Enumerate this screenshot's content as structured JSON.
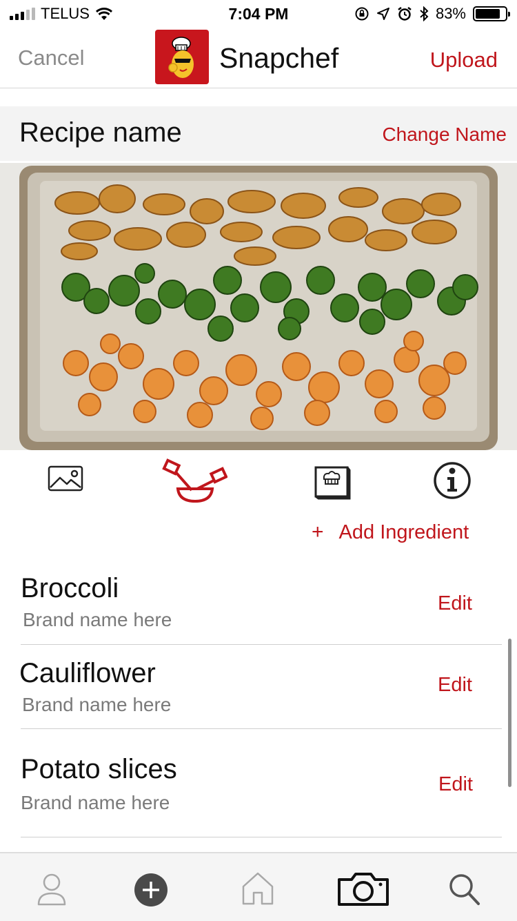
{
  "status_bar": {
    "carrier": "TELUS",
    "time": "7:04 PM",
    "battery": "83%",
    "battery_level": 0.83
  },
  "nav": {
    "cancel_label": "Cancel",
    "title": "Snapchef",
    "upload_label": "Upload"
  },
  "recipe": {
    "name": "Recipe name",
    "change_name_label": "Change Name"
  },
  "photo": {
    "description_icon": "sheet-pan-vegetables-photo"
  },
  "tabs": {
    "items": [
      "image-icon",
      "ingredients-icon",
      "recipe-book-icon",
      "info-icon"
    ],
    "active": "ingredients-icon"
  },
  "add_ingredient": {
    "plus": "+",
    "label": "Add Ingredient"
  },
  "ingredients": [
    {
      "name": "Broccoli",
      "brand": "Brand name here",
      "edit_label": "Edit"
    },
    {
      "name": "Cauliflower",
      "brand": "Brand name here",
      "edit_label": "Edit"
    },
    {
      "name": "Potato slices",
      "brand": "Brand name here",
      "edit_label": "Edit"
    }
  ],
  "bottom_bar": {
    "items": [
      "profile-icon",
      "add-icon",
      "home-icon",
      "camera-icon",
      "search-icon"
    ],
    "active": "camera-icon"
  },
  "colors": {
    "accent": "#c0161c",
    "muted_text": "#8a8a8a",
    "header_bg": "#f3f3f3"
  }
}
